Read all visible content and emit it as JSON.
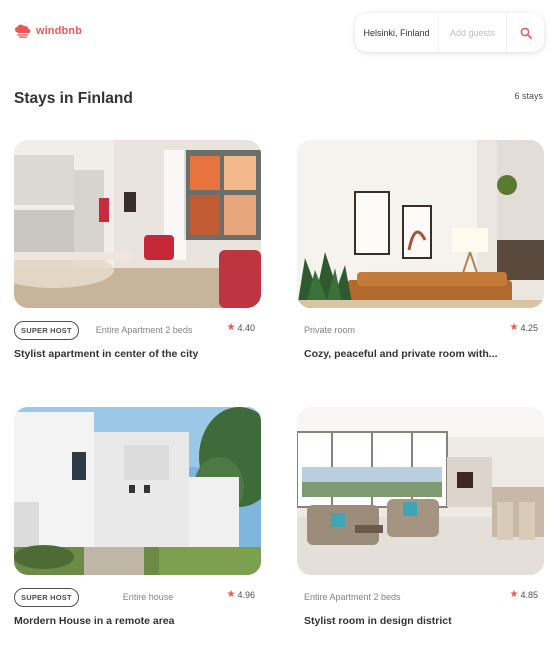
{
  "brand": {
    "name": "windbnb",
    "accent": "#eb5757"
  },
  "search": {
    "location": "Helsinki, Finland",
    "guests_placeholder": "Add guests",
    "icon": "search-icon"
  },
  "header": {
    "title": "Stays in Finland",
    "count": "6 stays"
  },
  "stays": [
    {
      "super_host": "SUPER HOST",
      "type": "Entire Apartment 2 beds",
      "rating": "4.40",
      "title": "Stylist apartment in center of the city"
    },
    {
      "super_host": "",
      "type": "Private room",
      "rating": "4.25",
      "title": "Cozy, peaceful and private room with..."
    },
    {
      "super_host": "SUPER HOST",
      "type": "Entire house",
      "rating": "4.96",
      "title": "Mordern House in a remote area"
    },
    {
      "super_host": "",
      "type": "Entire Apartment 2 beds",
      "rating": "4.85",
      "title": "Stylist room in design district"
    }
  ]
}
